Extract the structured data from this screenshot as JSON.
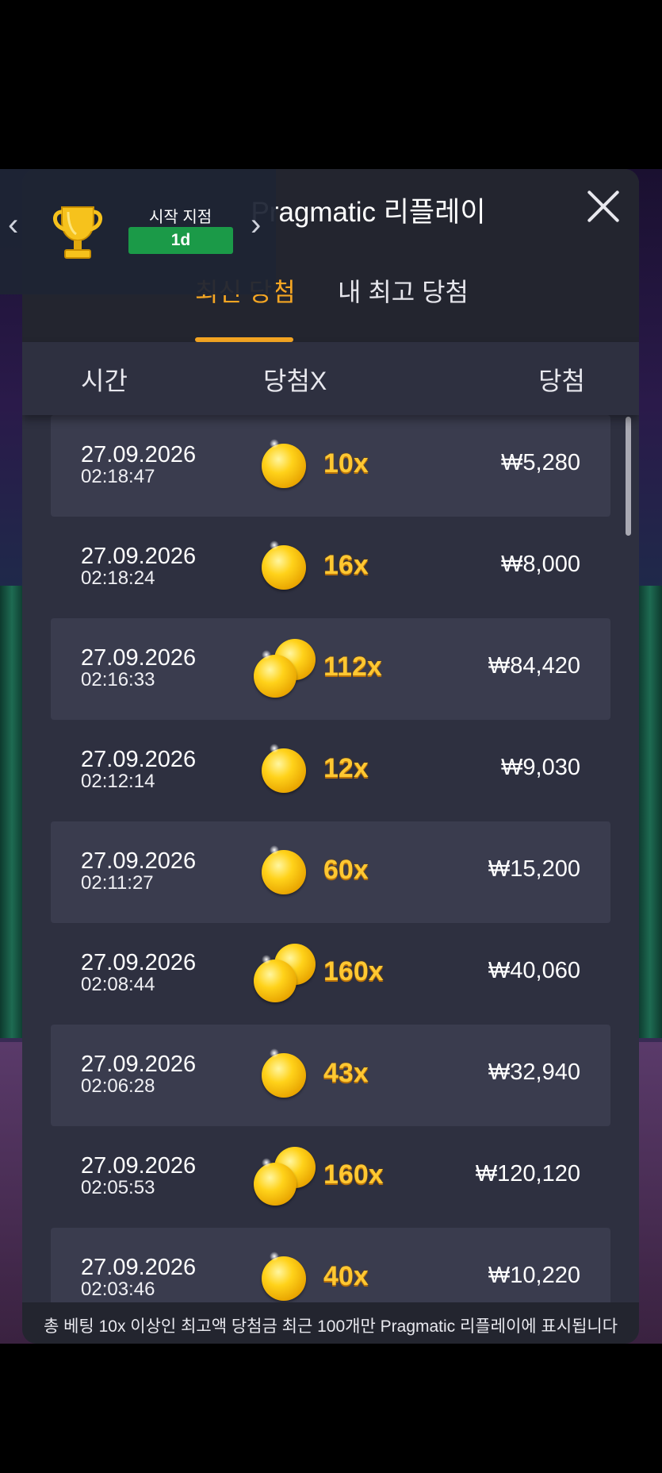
{
  "dialog": {
    "title": "Pragmatic 리플레이",
    "close_icon": "close-icon"
  },
  "tabs": [
    {
      "label": "최신 당첨",
      "active": true
    },
    {
      "label": "내 최고 당첨",
      "active": false
    }
  ],
  "columns": {
    "time": "시간",
    "multiplier": "당첨X",
    "win": "당첨"
  },
  "rows": [
    {
      "date": "27.09.2026",
      "time": "02:18:47",
      "multiplier": "10x",
      "win": "₩5,280",
      "coins": 1
    },
    {
      "date": "27.09.2026",
      "time": "02:18:24",
      "multiplier": "16x",
      "win": "₩8,000",
      "coins": 1
    },
    {
      "date": "27.09.2026",
      "time": "02:16:33",
      "multiplier": "112x",
      "win": "₩84,420",
      "coins": 2
    },
    {
      "date": "27.09.2026",
      "time": "02:12:14",
      "multiplier": "12x",
      "win": "₩9,030",
      "coins": 1
    },
    {
      "date": "27.09.2026",
      "time": "02:11:27",
      "multiplier": "60x",
      "win": "₩15,200",
      "coins": 1
    },
    {
      "date": "27.09.2026",
      "time": "02:08:44",
      "multiplier": "160x",
      "win": "₩40,060",
      "coins": 2
    },
    {
      "date": "27.09.2026",
      "time": "02:06:28",
      "multiplier": "43x",
      "win": "₩32,940",
      "coins": 1
    },
    {
      "date": "27.09.2026",
      "time": "02:05:53",
      "multiplier": "160x",
      "win": "₩120,120",
      "coins": 2
    },
    {
      "date": "27.09.2026",
      "time": "02:03:46",
      "multiplier": "40x",
      "win": "₩10,220",
      "coins": 1
    }
  ],
  "footer": "총 베팅 10x 이상인 최고액 당첨금 최근 100개만 Pragmatic 리플레이에 표시됩니다",
  "promo": {
    "label": "시작 지점",
    "badge": "1d",
    "prev_icon": "chevron-left-icon",
    "next_icon": "chevron-right-icon",
    "trophy_icon": "trophy-icon"
  },
  "colors": {
    "accent": "#f5a623",
    "multiplier": "#ffc832",
    "badge": "#1b9a48",
    "dialog_bg": "#2e3040",
    "header_bg": "#23252f"
  }
}
